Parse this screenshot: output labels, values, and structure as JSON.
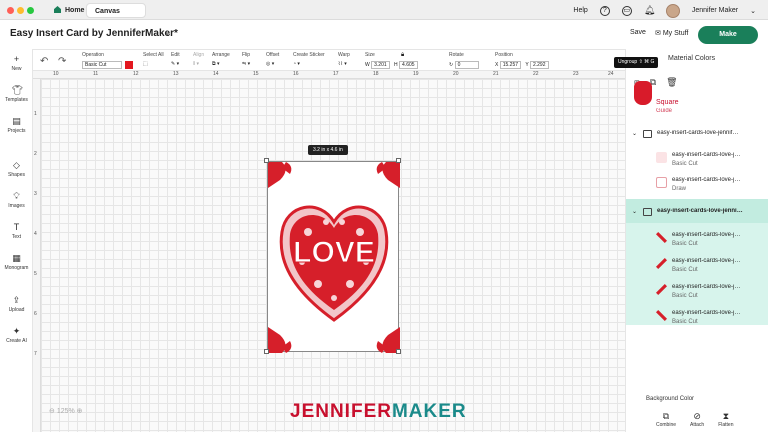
{
  "os_bar": {
    "tabs": [
      "Home",
      "Canvas"
    ],
    "help": "Help",
    "user": "Jennifer Maker"
  },
  "title_row": {
    "doc_title": "Easy Insert Card by JenniferMaker*",
    "save": "Save",
    "my_stuff": "My Stuff",
    "make": "Make"
  },
  "toolbar": {
    "operation": {
      "label": "Operation",
      "value": "Basic Cut",
      "color": "#e3171f"
    },
    "select_all": "Select All",
    "edit": "Edit",
    "align": "Align",
    "arrange": "Arrange",
    "flip": "Flip",
    "offset": "Offset",
    "create_sticker": "Create Sticker",
    "warp": "Warp",
    "size": {
      "label": "Size",
      "w_label": "W",
      "w": "3.201",
      "h_label": "H",
      "h": "4.605"
    },
    "rotate": {
      "label": "Rotate",
      "value": "0"
    },
    "position": {
      "label": "Position",
      "x_label": "X",
      "x": "15.257",
      "y_label": "Y",
      "y": "2.292"
    }
  },
  "left_rail": [
    "New",
    "Templates",
    "Projects",
    "Shapes",
    "Images",
    "Text",
    "Monogram",
    "Upload",
    "Create AI"
  ],
  "rulers": {
    "top": [
      "10",
      "11",
      "12",
      "13",
      "14",
      "15",
      "16",
      "17",
      "18",
      "19",
      "20",
      "21",
      "22",
      "23",
      "24"
    ],
    "left": [
      "1",
      "2",
      "3",
      "4",
      "5",
      "6",
      "7"
    ]
  },
  "canvas": {
    "size_tooltip": "3.2 in x 4.6 in",
    "zoom": "125%",
    "watermark_a": "JENNIFER",
    "watermark_b": "MAKER",
    "love_text": "LOVE"
  },
  "panel": {
    "material_colors": "Material Colors",
    "tooltip": "Ungroup ⇧ ⌘ G",
    "square": "Square",
    "guide": "Guide",
    "group1": "easy-insert-cards-love-jennif…",
    "g1_items": [
      {
        "name": "easy-insert-cards-love-j…",
        "op": "Basic Cut"
      },
      {
        "name": "easy-insert-cards-love-j…",
        "op": "Draw"
      }
    ],
    "group2": "easy-insert-cards-love-jenni…",
    "g2_items": [
      {
        "name": "easy-insert-cards-love-j…",
        "op": "Basic Cut"
      },
      {
        "name": "easy-insert-cards-love-j…",
        "op": "Basic Cut"
      },
      {
        "name": "easy-insert-cards-love-j…",
        "op": "Basic Cut"
      },
      {
        "name": "easy-insert-cards-love-j…",
        "op": "Basic Cut"
      }
    ],
    "background_color": "Background Color",
    "bottom_tools": [
      "Combine",
      "Attach",
      "Flatten"
    ]
  },
  "colors": {
    "brand_green": "#1a7f5a",
    "cut_red": "#e3171f",
    "highlight": "#d7f4ec"
  }
}
